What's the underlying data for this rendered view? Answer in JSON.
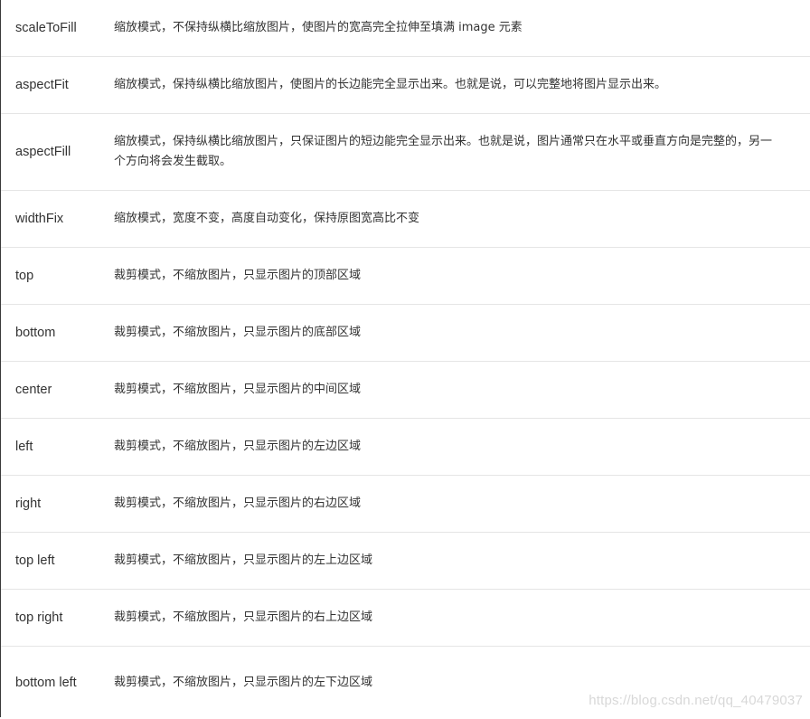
{
  "rows": [
    {
      "name": "scaleToFill",
      "desc": "缩放模式，不保持纵横比缩放图片，使图片的宽高完全拉伸至填满 image 元素"
    },
    {
      "name": "aspectFit",
      "desc": "缩放模式，保持纵横比缩放图片，使图片的长边能完全显示出来。也就是说，可以完整地将图片显示出来。"
    },
    {
      "name": "aspectFill",
      "desc": "缩放模式，保持纵横比缩放图片，只保证图片的短边能完全显示出来。也就是说，图片通常只在水平或垂直方向是完整的，另一个方向将会发生截取。"
    },
    {
      "name": "widthFix",
      "desc": "缩放模式，宽度不变，高度自动变化，保持原图宽高比不变"
    },
    {
      "name": "top",
      "desc": "裁剪模式，不缩放图片，只显示图片的顶部区域"
    },
    {
      "name": "bottom",
      "desc": "裁剪模式，不缩放图片，只显示图片的底部区域"
    },
    {
      "name": "center",
      "desc": "裁剪模式，不缩放图片，只显示图片的中间区域"
    },
    {
      "name": "left",
      "desc": "裁剪模式，不缩放图片，只显示图片的左边区域"
    },
    {
      "name": "right",
      "desc": "裁剪模式，不缩放图片，只显示图片的右边区域"
    },
    {
      "name": "top left",
      "desc": "裁剪模式，不缩放图片，只显示图片的左上边区域"
    },
    {
      "name": "top right",
      "desc": "裁剪模式，不缩放图片，只显示图片的右上边区域"
    },
    {
      "name": "bottom left",
      "desc": "裁剪模式，不缩放图片，只显示图片的左下边区域"
    }
  ],
  "watermark": "https://blog.csdn.net/qq_40479037"
}
